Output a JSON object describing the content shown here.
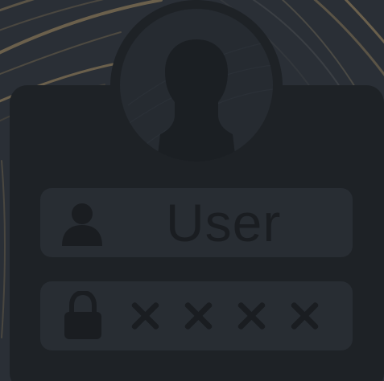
{
  "login": {
    "username_placeholder": "User",
    "password_mask": [
      "×",
      "×",
      "×",
      "×"
    ]
  },
  "icons": {
    "avatar": "user-silhouette-icon",
    "username": "person-icon",
    "password": "padlock-icon"
  },
  "colors": {
    "background": "#2a2f36",
    "card": "#1e2226",
    "field": "#282d33",
    "swirl_accent": "#6b604c",
    "glyph": "#1a1d21"
  }
}
